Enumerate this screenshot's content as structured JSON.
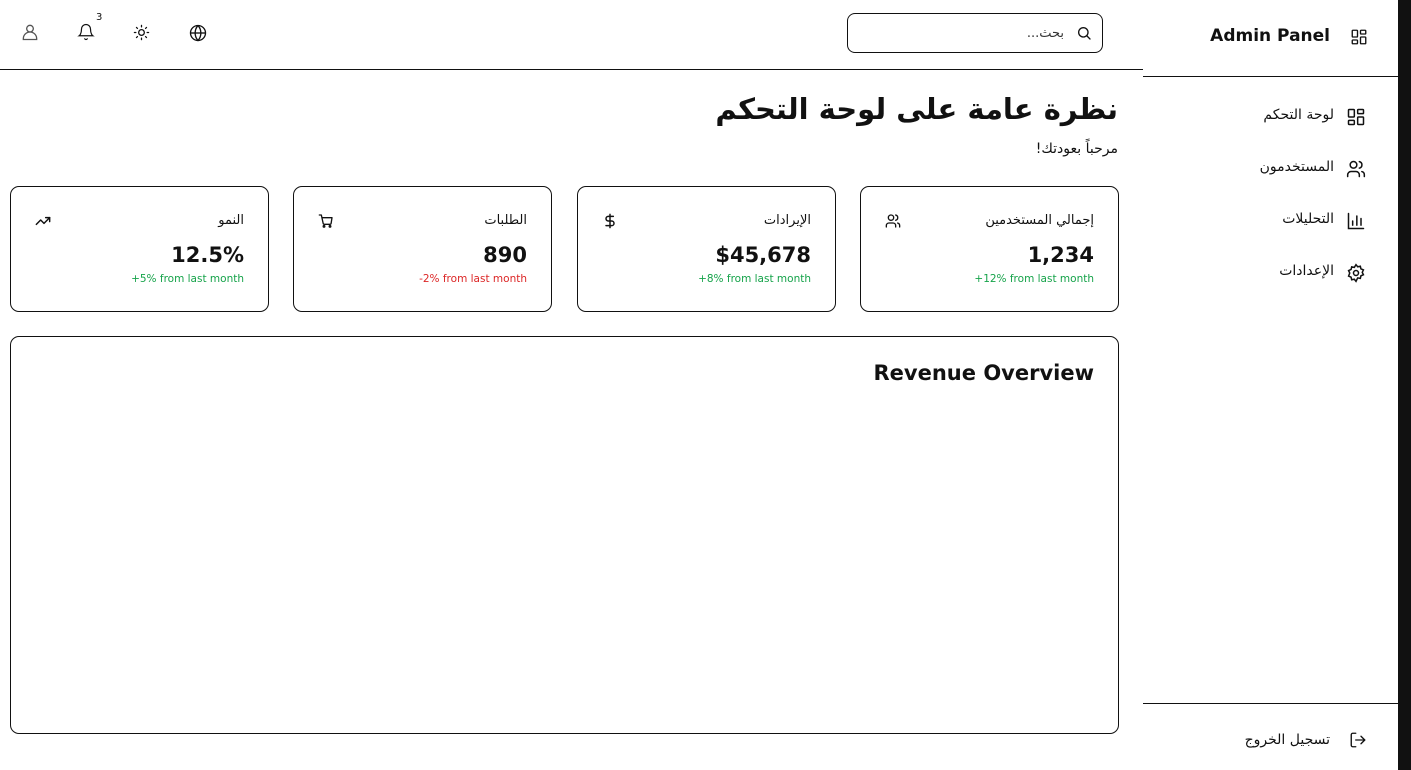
{
  "sidebar": {
    "brand": "Admin Panel",
    "brand_icon": "dashboard-grid-icon",
    "items": [
      {
        "label": "لوحة التحكم",
        "icon": "dashboard-grid-icon"
      },
      {
        "label": "المستخدمون",
        "icon": "users-icon"
      },
      {
        "label": "التحليلات",
        "icon": "bar-chart-icon"
      },
      {
        "label": "الإعدادات",
        "icon": "gear-icon"
      }
    ],
    "logout": {
      "label": "تسجيل الخروج",
      "icon": "logout-icon"
    }
  },
  "header": {
    "search": {
      "placeholder": "بحث...",
      "value": ""
    },
    "notifications_count": "3",
    "icons": [
      "user-icon",
      "bell-icon",
      "sun-icon",
      "globe-icon",
      "search-icon"
    ]
  },
  "main": {
    "title": "نظرة عامة على لوحة التحكم",
    "subtitle": "مرحباً بعودتك!",
    "stats": [
      {
        "label": "إجمالي المستخدمين",
        "value": "1,234",
        "change": "+12% from last month",
        "trend": "positive",
        "icon": "users-icon"
      },
      {
        "label": "الإيرادات",
        "value": "$45,678",
        "change": "+8% from last month",
        "trend": "positive",
        "icon": "dollar-icon"
      },
      {
        "label": "الطلبات",
        "value": "890",
        "change": "-2% from last month",
        "trend": "negative",
        "icon": "cart-icon"
      },
      {
        "label": "النمو",
        "value": "12.5%",
        "change": "+5% from last month",
        "trend": "positive",
        "icon": "trending-up-icon"
      }
    ],
    "revenue_chart": {
      "title": "Revenue Overview"
    }
  },
  "colors": {
    "positive": "#16a34a",
    "negative": "#dc2626",
    "border": "#111111",
    "background": "#ffffff"
  }
}
